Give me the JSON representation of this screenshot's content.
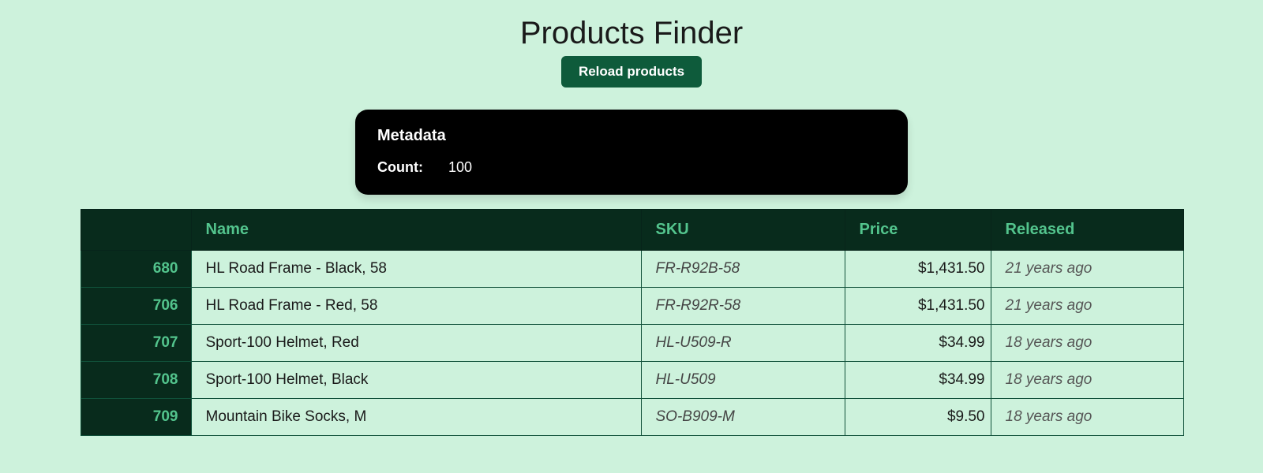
{
  "title": "Products Finder",
  "buttons": {
    "reload": "Reload products"
  },
  "metadata": {
    "heading": "Metadata",
    "count_label": "Count:",
    "count_value": "100"
  },
  "table": {
    "headers": {
      "id": "",
      "name": "Name",
      "sku": "SKU",
      "price": "Price",
      "released": "Released"
    },
    "rows": [
      {
        "id": "680",
        "name": "HL Road Frame - Black, 58",
        "sku": "FR-R92B-58",
        "price": "$1,431.50",
        "released": "21 years ago"
      },
      {
        "id": "706",
        "name": "HL Road Frame - Red, 58",
        "sku": "FR-R92R-58",
        "price": "$1,431.50",
        "released": "21 years ago"
      },
      {
        "id": "707",
        "name": "Sport-100 Helmet, Red",
        "sku": "HL-U509-R",
        "price": "$34.99",
        "released": "18 years ago"
      },
      {
        "id": "708",
        "name": "Sport-100 Helmet, Black",
        "sku": "HL-U509",
        "price": "$34.99",
        "released": "18 years ago"
      },
      {
        "id": "709",
        "name": "Mountain Bike Socks, M",
        "sku": "SO-B909-M",
        "price": "$9.50",
        "released": "18 years ago"
      }
    ]
  }
}
